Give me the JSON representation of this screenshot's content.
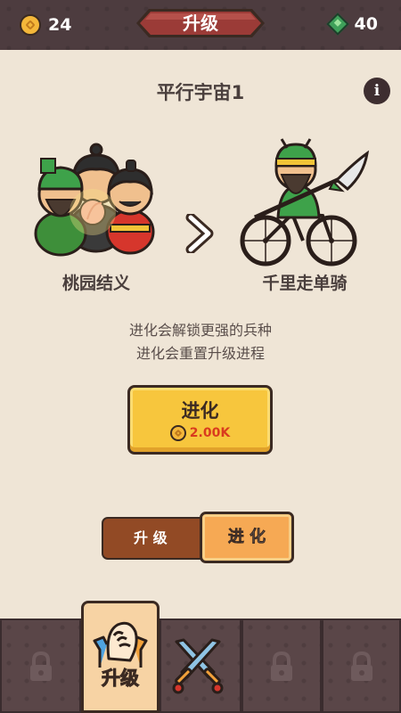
{
  "header": {
    "coins": "24",
    "gems": "40",
    "title": "升级"
  },
  "main": {
    "universe_title": "平行宇宙1",
    "info_label": "i",
    "current_stage": {
      "name": "桃园结义"
    },
    "next_stage": {
      "name": "千里走单骑"
    },
    "description_lines": [
      "进化会解锁更强的兵种",
      "进化会重置升级进程"
    ],
    "evolve_button": {
      "label": "进化",
      "cost": "2.00K"
    }
  },
  "toggle": {
    "upgrade_label": "升 级",
    "evolve_label": "进 化",
    "selected": "evolve"
  },
  "tabs": [
    {
      "id": "locked-1",
      "locked": true,
      "icon": "lock-icon"
    },
    {
      "id": "upgrade",
      "label": "升级",
      "selected": true,
      "icon": "fist-icon"
    },
    {
      "id": "battle",
      "locked": false,
      "icon": "crossed-swords-icon"
    },
    {
      "id": "locked-2",
      "locked": true,
      "icon": "lock-icon"
    },
    {
      "id": "locked-3",
      "locked": true,
      "icon": "lock-icon"
    }
  ],
  "colors": {
    "background": "#efe5d6",
    "topbar": "#4d3c3f",
    "banner": "#9b3b37",
    "evolve_button": "#f7c63d",
    "cost_text": "#d93b1e",
    "toggle_upgrade": "#924a25",
    "toggle_evolve": "#f6a954",
    "tab_bg": "#5a4648",
    "tab_selected": "#f7d3a4"
  }
}
